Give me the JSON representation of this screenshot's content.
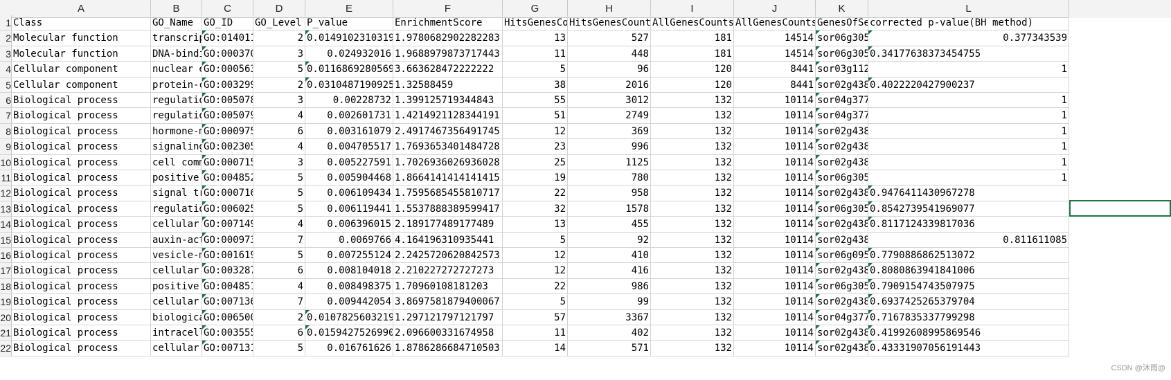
{
  "columns": [
    {
      "letter": "A"
    },
    {
      "letter": "B"
    },
    {
      "letter": "C"
    },
    {
      "letter": "D"
    },
    {
      "letter": "E"
    },
    {
      "letter": "F"
    },
    {
      "letter": "G"
    },
    {
      "letter": "H"
    },
    {
      "letter": "I"
    },
    {
      "letter": "J"
    },
    {
      "letter": "K"
    },
    {
      "letter": "L"
    }
  ],
  "rows": [
    {
      "rownum": "1",
      "cells": [
        "Class",
        "GO_Name",
        "GO_ID",
        "GO_Level",
        "P_value",
        "EnrichmentScore",
        "HitsGenesCo",
        "HitsGenesCount",
        "AllGenesCounts",
        "AllGenesCounts",
        "GenesOfSe",
        "corrected p-value(BH method)"
      ]
    },
    {
      "rownum": "2",
      "cells": [
        "Molecular function",
        "transcrip",
        "GO:014011",
        "2",
        "0.0149102310319",
        "1.9780682902282283",
        "13",
        "527",
        "181",
        "14514",
        "sor06g305",
        "0.377343539"
      ]
    },
    {
      "rownum": "3",
      "cells": [
        "Molecular function",
        "DNA-bindi",
        "GO:000370",
        "3",
        "0.024932016",
        "1.9688979873717443",
        "11",
        "448",
        "181",
        "14514",
        "sor06g305",
        "0.34177638373454755"
      ]
    },
    {
      "rownum": "4",
      "cells": [
        "Cellular component",
        "nuclear e",
        "GO:000563",
        "5",
        "0.0116869280569",
        "3.663628472222222",
        "5",
        "96",
        "120",
        "8441",
        "sor03g112",
        "1"
      ]
    },
    {
      "rownum": "5",
      "cells": [
        "Cellular component",
        "protein-c",
        "GO:003299",
        "2",
        "0.0310487190925",
        "1.32588459",
        "38",
        "2016",
        "120",
        "8441",
        "sor02g438",
        "0.4022220427900237"
      ]
    },
    {
      "rownum": "6",
      "cells": [
        "Biological process",
        "regulatio",
        "GO:005078",
        "3",
        "0.00228732",
        "1.399125719344843",
        "55",
        "3012",
        "132",
        "10114",
        "sor04g377",
        "1"
      ]
    },
    {
      "rownum": "7",
      "cells": [
        "Biological process",
        "regulatio",
        "GO:005079",
        "4",
        "0.002601731",
        "1.4214921128344191",
        "51",
        "2749",
        "132",
        "10114",
        "sor04g377",
        "1"
      ]
    },
    {
      "rownum": "8",
      "cells": [
        "Biological process",
        "hormone-m",
        "GO:000975",
        "6",
        "0.003161079",
        "2.4917467356491745",
        "12",
        "369",
        "132",
        "10114",
        "sor02g438",
        "1"
      ]
    },
    {
      "rownum": "9",
      "cells": [
        "Biological process",
        "signaling",
        "GO:002305",
        "4",
        "0.004705517",
        "1.7693653401484728",
        "23",
        "996",
        "132",
        "10114",
        "sor02g438",
        "1"
      ]
    },
    {
      "rownum": "10",
      "cells": [
        "Biological process",
        "cell comm",
        "GO:000715",
        "3",
        "0.005227591",
        "1.7026936026936028",
        "25",
        "1125",
        "132",
        "10114",
        "sor02g438",
        "1"
      ]
    },
    {
      "rownum": "11",
      "cells": [
        "Biological process",
        "positive",
        "GO:004852",
        "5",
        "0.005904468",
        "1.8664141414141415",
        "19",
        "780",
        "132",
        "10114",
        "sor06g305",
        "1"
      ]
    },
    {
      "rownum": "12",
      "cells": [
        "Biological process",
        "signal tr",
        "GO:000716",
        "5",
        "0.006109434",
        "1.7595685455810717",
        "22",
        "958",
        "132",
        "10114",
        "sor02g438",
        "0.9476411430967278"
      ]
    },
    {
      "rownum": "13",
      "cells": [
        "Biological process",
        "regulatio",
        "GO:006025",
        "5",
        "0.006119441",
        "1.5537888389599417",
        "32",
        "1578",
        "132",
        "10114",
        "sor06g305",
        "0.8542739541969077"
      ]
    },
    {
      "rownum": "14",
      "cells": [
        "Biological process",
        "cellular",
        "GO:007149",
        "4",
        "0.006396015",
        "2.189177489177489",
        "13",
        "455",
        "132",
        "10114",
        "sor02g438",
        "0.8117124339817036"
      ]
    },
    {
      "rownum": "15",
      "cells": [
        "Biological process",
        "auxin-act",
        "GO:000973",
        "7",
        "0.0069766",
        "4.164196310935441",
        "5",
        "92",
        "132",
        "10114",
        "sor02g438",
        "0.811611085"
      ]
    },
    {
      "rownum": "16",
      "cells": [
        "Biological process",
        "vesicle-m",
        "GO:001619",
        "5",
        "0.007255124",
        "2.2425720620842573",
        "12",
        "410",
        "132",
        "10114",
        "sor06g095",
        "0.7790886862513072"
      ]
    },
    {
      "rownum": "17",
      "cells": [
        "Biological process",
        "cellular",
        "GO:003287",
        "6",
        "0.008104018",
        "2.210227272727273",
        "12",
        "416",
        "132",
        "10114",
        "sor02g438",
        "0.8080863941841006"
      ]
    },
    {
      "rownum": "18",
      "cells": [
        "Biological process",
        "positive",
        "GO:004851",
        "4",
        "0.008498375",
        "1.70960108181203",
        "22",
        "986",
        "132",
        "10114",
        "sor06g305",
        "0.7909154743507975"
      ]
    },
    {
      "rownum": "19",
      "cells": [
        "Biological process",
        "cellular",
        "GO:007136",
        "7",
        "0.009442054",
        "3.8697581879400067",
        "5",
        "99",
        "132",
        "10114",
        "sor02g438",
        "0.6937425265379704"
      ]
    },
    {
      "rownum": "20",
      "cells": [
        "Biological process",
        "biologica",
        "GO:006500",
        "2",
        "0.0107825603219",
        "1.297121797121797",
        "57",
        "3367",
        "132",
        "10114",
        "sor04g377",
        "0.7167835337799298"
      ]
    },
    {
      "rownum": "21",
      "cells": [
        "Biological process",
        "intracell",
        "GO:003555",
        "6",
        "0.0159427526990",
        "2.096600331674958",
        "11",
        "402",
        "132",
        "10114",
        "sor02g438",
        "0.41992608995869546"
      ]
    },
    {
      "rownum": "22",
      "cells": [
        "Biological process",
        "cellular",
        "GO:007131",
        "5",
        "0.016761626",
        "1.8786286684710503",
        "14",
        "571",
        "132",
        "10114",
        "sor02g438",
        "0.43331907056191443"
      ]
    }
  ],
  "watermark": "CSDN @沐雨@"
}
